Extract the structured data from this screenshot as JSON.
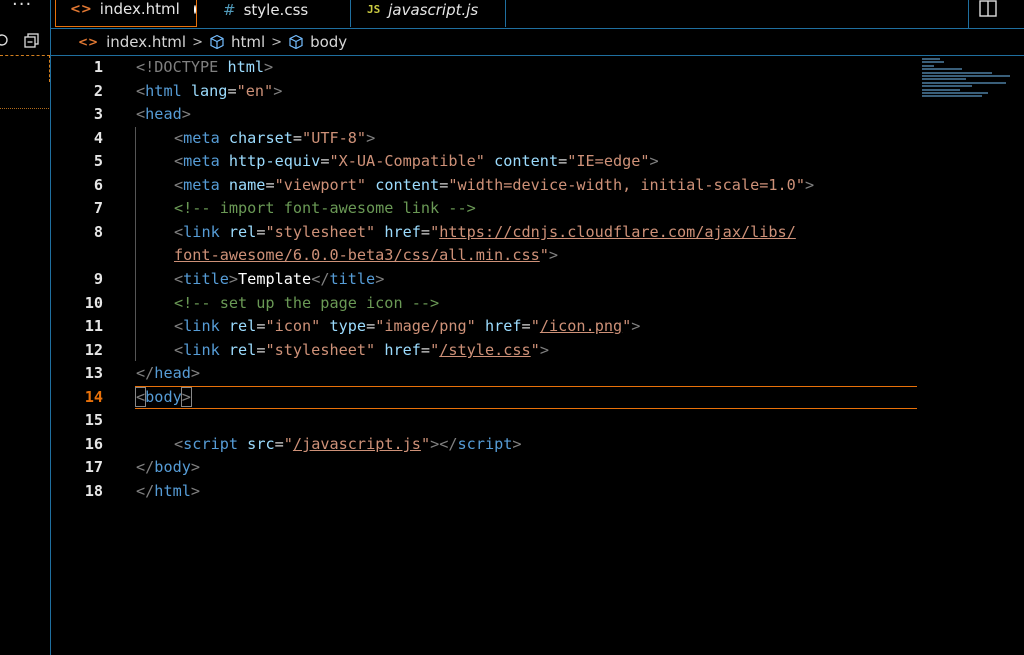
{
  "sidebar": {
    "more_label": "···"
  },
  "tabs": [
    {
      "label": "index.html",
      "icon": "html-file-icon",
      "active": true,
      "dirty": true
    },
    {
      "label": "style.css",
      "icon": "css-file-icon"
    },
    {
      "label": "javascript.js",
      "icon": "js-file-icon"
    }
  ],
  "tab_icons": {
    "html": "<>",
    "css": "#",
    "js": "JS"
  },
  "breadcrumb": {
    "file": "index.html",
    "html": "html",
    "body": "body",
    "sep": ">"
  },
  "editor": {
    "line_numbers": [
      "1",
      "2",
      "3",
      "4",
      "5",
      "6",
      "7",
      "8",
      "9",
      "10",
      "11",
      "12",
      "13",
      "14",
      "15",
      "16",
      "17",
      "18"
    ],
    "active_line": "14",
    "lines": {
      "l1_a": "<!DOCTYPE",
      "l1_b": " html",
      "l1_c": ">",
      "l2_a": "<",
      "l2_b": "html",
      "l2_c": " lang",
      "l2_d": "=",
      "l2_e": "\"en\"",
      "l2_f": ">",
      "l3_a": "<",
      "l3_b": "head",
      "l3_c": ">",
      "l4_a": "<",
      "l4_b": "meta",
      "l4_c": " charset",
      "l4_d": "=",
      "l4_e": "\"UTF-8\"",
      "l4_f": ">",
      "l5_a": "<",
      "l5_b": "meta",
      "l5_c": " http-equiv",
      "l5_d": "=",
      "l5_e": "\"X-UA-Compatible\"",
      "l5_f": " content",
      "l5_g": "=",
      "l5_h": "\"IE=edge\"",
      "l5_i": ">",
      "l6_a": "<",
      "l6_b": "meta",
      "l6_c": " name",
      "l6_d": "=",
      "l6_e": "\"viewport\"",
      "l6_f": " content",
      "l6_g": "=",
      "l6_h": "\"width=device-width, initial-scale=1.0\"",
      "l6_i": ">",
      "l7": "<!-- import font-awesome link -->",
      "l8_a": "<",
      "l8_b": "link",
      "l8_c": " rel",
      "l8_d": "=",
      "l8_e": "\"stylesheet\"",
      "l8_f": " href",
      "l8_g": "=",
      "l8_h": "\"",
      "l8_i": "https://cdnjs.cloudflare.com/ajax/libs/",
      "l8w_a": "font-awesome/6.0.0-beta3/css/all.min.css",
      "l8w_b": "\"",
      "l8w_c": ">",
      "l9_a": "<",
      "l9_b": "title",
      "l9_c": ">",
      "l9_d": "Template",
      "l9_e": "</",
      "l9_f": "title",
      "l9_g": ">",
      "l10": "<!-- set up the page icon -->",
      "l11_a": "<",
      "l11_b": "link",
      "l11_c": " rel",
      "l11_d": "=",
      "l11_e": "\"icon\"",
      "l11_f": " type",
      "l11_g": "=",
      "l11_h": "\"image/png\"",
      "l11_i": " href",
      "l11_j": "=",
      "l11_k": "\"",
      "l11_l": "/icon.png",
      "l11_m": "\"",
      "l11_n": ">",
      "l12_a": "<",
      "l12_b": "link",
      "l12_c": " rel",
      "l12_d": "=",
      "l12_e": "\"stylesheet\"",
      "l12_f": " href",
      "l12_g": "=",
      "l12_h": "\"",
      "l12_i": "/style.css",
      "l12_j": "\"",
      "l12_k": ">",
      "l13_a": "</",
      "l13_b": "head",
      "l13_c": ">",
      "l14_a": "<",
      "l14_b": "body",
      "l14_c": ">",
      "l16_a": "<",
      "l16_b": "script",
      "l16_c": " src",
      "l16_d": "=",
      "l16_e": "\"",
      "l16_f": "/javascript.js",
      "l16_g": "\"",
      "l16_h": "></",
      "l16_i": "script",
      "l16_j": ">",
      "l17_a": "</",
      "l17_b": "body",
      "l17_c": ">",
      "l18_a": "</",
      "l18_b": "html",
      "l18_c": ">"
    }
  },
  "colors": {
    "accent": "#e8710a",
    "tag": "#569cd6",
    "attr": "#9cdcfe",
    "string": "#ce9178",
    "comment": "#6a9955",
    "border": "#1f6f9f"
  }
}
